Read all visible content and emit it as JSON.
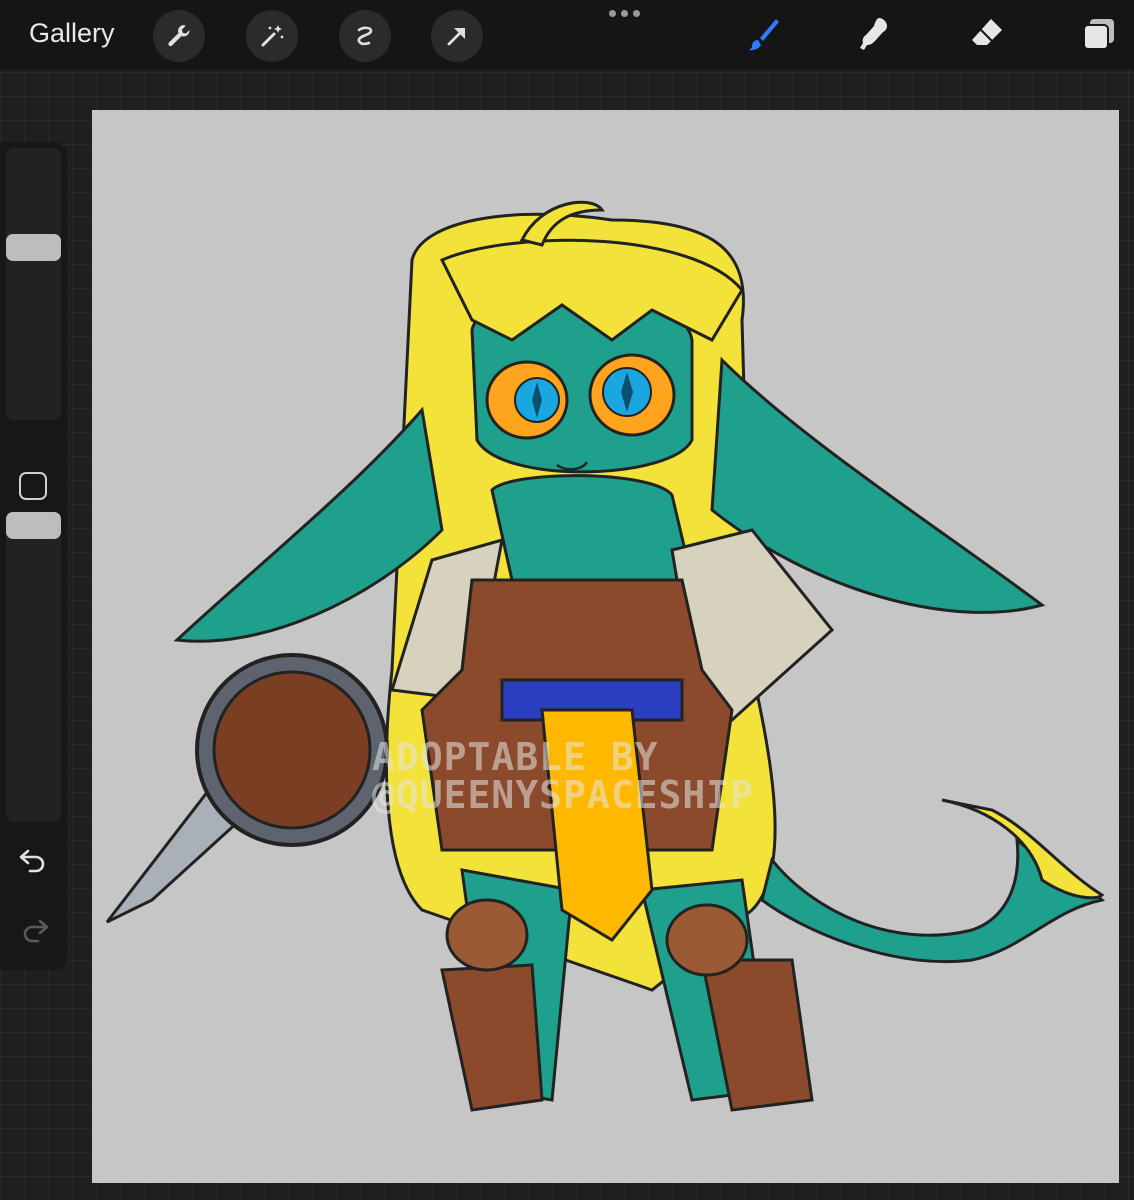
{
  "toolbar": {
    "gallery_label": "Gallery",
    "left_tools": [
      "wrench-icon",
      "magic-wand-icon",
      "selection-icon",
      "transform-arrow-icon"
    ],
    "right_tools": [
      "brush-icon",
      "smudge-icon",
      "eraser-icon",
      "layers-icon"
    ],
    "active_tool": "brush-icon",
    "accent_color": "#2f7bff"
  },
  "sidebar": {
    "size_slider_level": 0.65,
    "opacity_slider_level": 0.2,
    "undo_icon": "undo-icon",
    "redo_icon": "redo-icon"
  },
  "canvas": {
    "background_color": "#c6c6c6",
    "watermark_lines": [
      "ADOPTABLE BY",
      "@QUEENYSPACESHIP"
    ]
  }
}
